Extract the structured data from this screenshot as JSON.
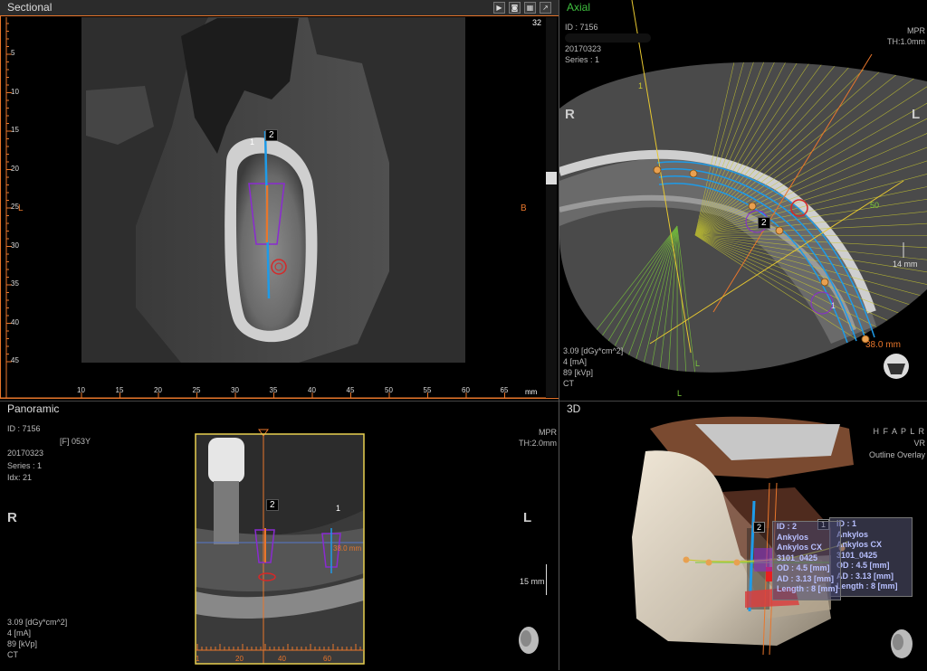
{
  "sectional": {
    "title": "Sectional",
    "slice_number": "32",
    "left_orient": "L",
    "right_orient": "B",
    "mm_label": "mm",
    "v_ticks": [
      "5",
      "10",
      "15",
      "20",
      "25",
      "30",
      "35",
      "40",
      "45"
    ],
    "h_ticks": [
      "10",
      "15",
      "20",
      "25",
      "30",
      "35",
      "40",
      "45",
      "50",
      "55",
      "60",
      "65"
    ],
    "implant_label": "2",
    "implant_marker": "1",
    "toolbar": [
      "play-icon",
      "camera-icon",
      "grid-icon",
      "pin-icon"
    ]
  },
  "axial": {
    "title": "Axial",
    "id": "ID : 7156",
    "date": "20170323",
    "series": "Series : 1",
    "mode": "MPR",
    "thickness": "TH:1.0mm",
    "orient_left": "R",
    "orient_right": "L",
    "dose": "3.09  [dGy*cm^2]",
    "ma": "4  [mA]",
    "kvp": "89 [kVp]",
    "modality": "CT",
    "arch_length": "38.0 mm",
    "scale": "14 mm",
    "marker_50": "50",
    "marker_1": "1",
    "marker_1b": "1",
    "marker_L": "L",
    "marker_L2": "L",
    "implant_label": "2"
  },
  "panoramic": {
    "title": "Panoramic",
    "id": "ID : 7156",
    "patient": "[F] 053Y",
    "date": "20170323",
    "series": "Series : 1",
    "idx": "Idx: 21",
    "mode": "MPR",
    "thickness": "TH:2.0mm",
    "orient_left": "R",
    "orient_right": "L",
    "scale": "15 mm",
    "dose": "3.09  [dGy*cm^2]",
    "ma": "4  [mA]",
    "kvp": "89 [kVp]",
    "modality": "CT",
    "implant_label": "2",
    "implant_marker": "1",
    "arch_length": "38.0 mm",
    "ruler_ticks": [
      "1",
      "20",
      "40",
      "60"
    ]
  },
  "view3d": {
    "title": "3D",
    "orientation": "H F A P L R",
    "mode": "VR",
    "overlay": "Outline Overlay",
    "implant1": {
      "badge": "1",
      "lines": [
        "ID : 1",
        "Ankylos",
        "Ankylos CX",
        "3101_0425",
        "OD : 4.5 [mm]",
        "AD : 3.13 [mm]",
        "Length : 8 [mm]"
      ]
    },
    "implant2": {
      "badge": "2",
      "lines": [
        "ID : 2",
        "Ankylos",
        "Ankylos CX",
        "3101_0425",
        "OD : 4.5 [mm]",
        "AD : 3.13 [mm]",
        "Length : 8 [mm]"
      ]
    }
  },
  "colors": {
    "accent_orange": "#e8762b",
    "implant_blue": "#1e9be8",
    "outline_purple": "#8a2bd0",
    "guide_yellow": "#c8c830",
    "axial_title_green": "#3fbf3f"
  }
}
